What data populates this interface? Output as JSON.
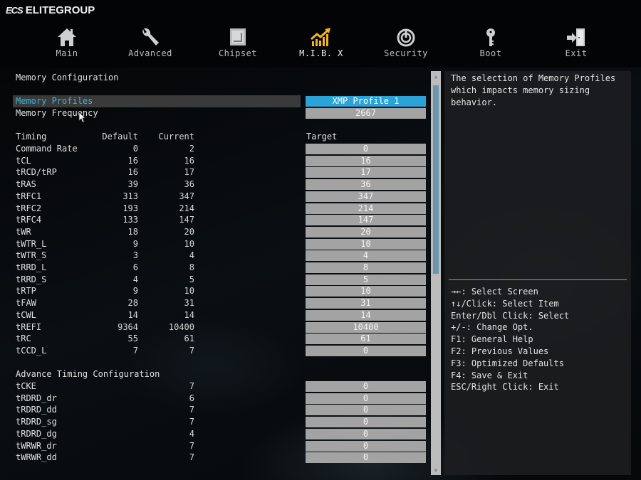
{
  "brand": {
    "mark": "ECS",
    "name": "ELITEGROUP"
  },
  "nav": [
    {
      "label": "Main",
      "icon": "home-icon",
      "active": false
    },
    {
      "label": "Advanced",
      "icon": "wrench-icon",
      "active": false
    },
    {
      "label": "Chipset",
      "icon": "chip-icon",
      "active": false
    },
    {
      "label": "M.I.B. X",
      "icon": "growth-chart-icon",
      "active": true
    },
    {
      "label": "Security",
      "icon": "power-icon",
      "active": false
    },
    {
      "label": "Boot",
      "icon": "key-icon",
      "active": false
    },
    {
      "label": "Exit",
      "icon": "exit-door-icon",
      "active": false
    }
  ],
  "section_title": "Memory Configuration",
  "settings": [
    {
      "label": "Memory Profiles",
      "value": "XMP Profile 1",
      "selected": true
    },
    {
      "label": "Memory Frequency",
      "value": "2667",
      "selected": false
    }
  ],
  "timing_headers": {
    "name": "Timing",
    "default": "Default",
    "current": "Current",
    "target": "Target"
  },
  "timings": [
    {
      "name": "Command Rate",
      "default": "0",
      "current": "2",
      "target": "0"
    },
    {
      "name": "tCL",
      "default": "16",
      "current": "16",
      "target": "16"
    },
    {
      "name": "tRCD/tRP",
      "default": "16",
      "current": "17",
      "target": "17"
    },
    {
      "name": "tRAS",
      "default": "39",
      "current": "36",
      "target": "36"
    },
    {
      "name": "tRFC1",
      "default": "313",
      "current": "347",
      "target": "347"
    },
    {
      "name": "tRFC2",
      "default": "193",
      "current": "214",
      "target": "214"
    },
    {
      "name": "tRFC4",
      "default": "133",
      "current": "147",
      "target": "147"
    },
    {
      "name": "tWR",
      "default": "18",
      "current": "20",
      "target": "20"
    },
    {
      "name": "tWTR_L",
      "default": "9",
      "current": "10",
      "target": "10"
    },
    {
      "name": "tWTR_S",
      "default": "3",
      "current": "4",
      "target": "4"
    },
    {
      "name": "tRRD_L",
      "default": "6",
      "current": "8",
      "target": "8"
    },
    {
      "name": "tRRD_S",
      "default": "4",
      "current": "5",
      "target": "5"
    },
    {
      "name": "tRTP",
      "default": "9",
      "current": "10",
      "target": "10"
    },
    {
      "name": "tFAW",
      "default": "28",
      "current": "31",
      "target": "31"
    },
    {
      "name": "tCWL",
      "default": "14",
      "current": "14",
      "target": "14"
    },
    {
      "name": "tREFI",
      "default": "9364",
      "current": "10400",
      "target": "10400"
    },
    {
      "name": "tRC",
      "default": "55",
      "current": "61",
      "target": "61"
    },
    {
      "name": "tCCD_L",
      "default": "7",
      "current": "7",
      "target": "0"
    }
  ],
  "advanced_title": "Advance Timing Configuration",
  "advanced": [
    {
      "name": "tCKE",
      "current": "7",
      "target": "0"
    },
    {
      "name": "tRDRD_dr",
      "current": "6",
      "target": "0"
    },
    {
      "name": "tRDRD_dd",
      "current": "7",
      "target": "0"
    },
    {
      "name": "tRDRD_sg",
      "current": "7",
      "target": "0"
    },
    {
      "name": "tRDRD_dg",
      "current": "4",
      "target": "0"
    },
    {
      "name": "tWRWR_dr",
      "current": "7",
      "target": "0"
    },
    {
      "name": "tWRWR_dd",
      "current": "7",
      "target": "0"
    }
  ],
  "help": {
    "description": "The selection of Memory Profiles\nwhich impacts memory sizing\nbehavior.",
    "keys": [
      "→←: Select Screen",
      "↑↓/Click: Select Item",
      "Enter/Dbl Click: Select",
      "+/-: Change Opt.",
      "F1: General Help",
      "F2: Previous Values",
      "F3: Optimized Defaults",
      "F4: Save & Exit",
      "ESC/Right Click: Exit"
    ]
  },
  "colors": {
    "accent": "#2aa3d8",
    "selected_text": "#3fb4d6",
    "active_icon": "#f2b51c",
    "field": "#a3a3a3",
    "scroll_thumb": "#6a95ad"
  }
}
